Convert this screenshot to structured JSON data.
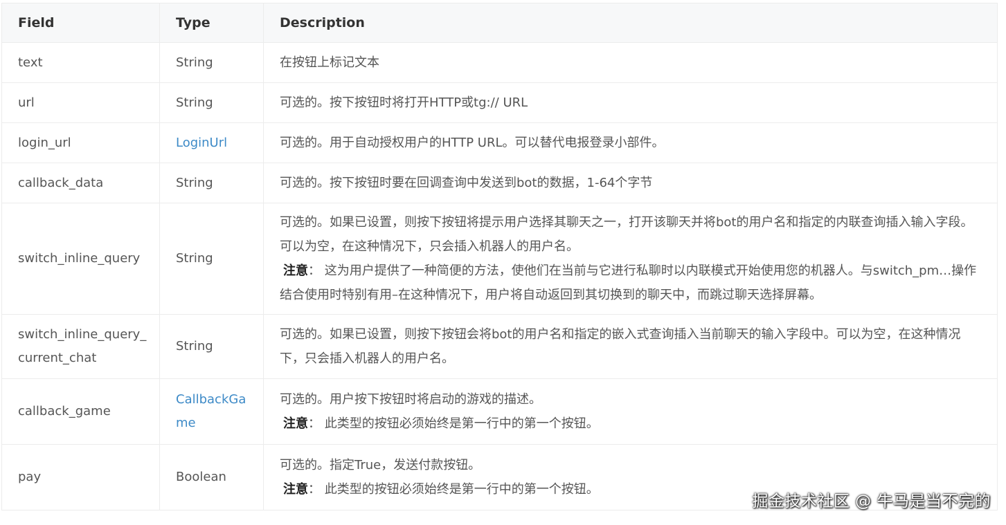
{
  "table": {
    "headers": {
      "field": "Field",
      "type": "Type",
      "description": "Description"
    },
    "rows": [
      {
        "field": "text",
        "type": "String",
        "desc": "在按钮上标记文本"
      },
      {
        "field": "url",
        "type": "String",
        "desc": "可选的。按下按钮时将打开HTTP或tg:// URL"
      },
      {
        "field": "login_url",
        "type": "LoginUrl",
        "desc": "可选的。用于自动授权用户的HTTP URL。可以替代电报登录小部件。"
      },
      {
        "field": "callback_data",
        "type": "String",
        "desc": "可选的。按下按钮时要在回调查询中发送到bot的数据，1-64个字节"
      },
      {
        "field": "switch_inline_query",
        "type": "String",
        "desc": "可选的。如果已设置，则按下按钮将提示用户选择其聊天之一，打开该聊天并将bot的用户名和指定的内联查询插入输入字段。可以为空，在这种情况下，只会插入机器人的用户名。",
        "note_label": "注意",
        "note": "： 这为用户提供了一种简便的方法，使他们在当前与它进行私聊时以内联模式开始使用您的机器人。与switch_pm…操作结合使用时特别有用–在这种情况下，用户将自动返回到其切换到的聊天中，而跳过聊天选择屏幕。"
      },
      {
        "field": "switch_inline_query_current_chat",
        "type": "String",
        "desc": "可选的。如果已设置，则按下按钮会将bot的用户名和指定的嵌入式查询插入当前聊天的输入字段中。可以为空，在这种情况下，只会插入机器人的用户名。"
      },
      {
        "field": "callback_game",
        "type": "CallbackGame",
        "desc": "可选的。用户按下按钮时将启动的游戏的描述。",
        "note_label": "注意",
        "note": "： 此类型的按钮必须始终是第一行中的第一个按钮。"
      },
      {
        "field": "pay",
        "type": "Boolean",
        "desc": "可选的。指定True，发送付款按钮。",
        "note_label": "注意",
        "note": "： 此类型的按钮必须始终是第一行中的第一个按钮。"
      }
    ]
  },
  "watermark": "掘金技术社区 @ 牛马是当不完的",
  "colors": {
    "link": "#3d8ac7",
    "header_bg": "#f7f8f9",
    "border": "#ececec"
  }
}
